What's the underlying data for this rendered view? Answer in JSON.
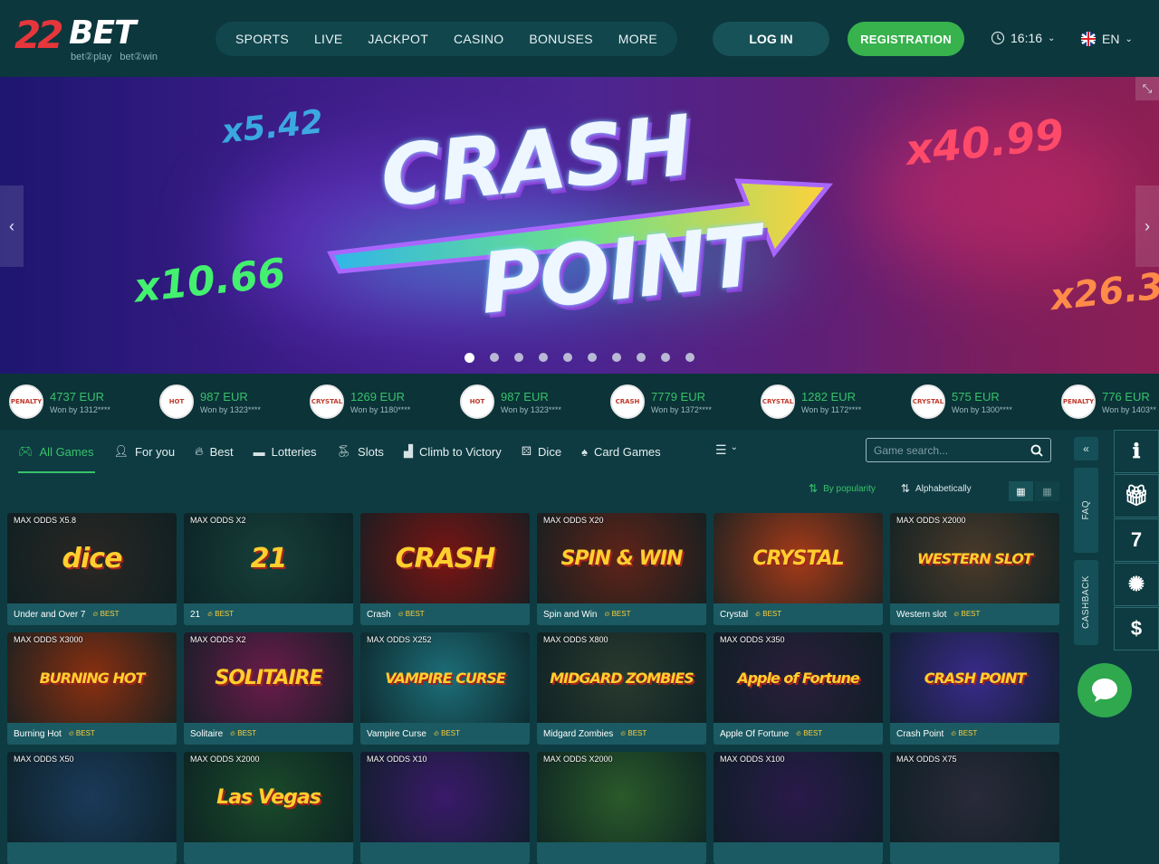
{
  "logo": {
    "number": "22",
    "brand": "BET",
    "tagline": "bet②play bet②win"
  },
  "nav": [
    "SPORTS",
    "LIVE",
    "JACKPOT",
    "CASINO",
    "BONUSES",
    "MORE"
  ],
  "auth": {
    "login": "LOG IN",
    "register": "REGISTRATION"
  },
  "clock": {
    "time": "16:16",
    "icon": "clock-icon"
  },
  "language": {
    "code": "EN",
    "icon": "uk-flag-icon"
  },
  "banner": {
    "title_line1": "CRASH",
    "title_line2": "POINT",
    "multipliers": [
      "x5.42",
      "x40.99",
      "x10.66",
      "x26.3"
    ],
    "slide_count": 10,
    "active_slide": 1
  },
  "winners": [
    {
      "amount": "4737 EUR",
      "by": "Won by 1312****",
      "thumb": "PENALTY"
    },
    {
      "amount": "987 EUR",
      "by": "Won by 1323****",
      "thumb": "HOT"
    },
    {
      "amount": "1269 EUR",
      "by": "Won by 1180****",
      "thumb": "CRYSTAL"
    },
    {
      "amount": "987 EUR",
      "by": "Won by 1323****",
      "thumb": "HOT"
    },
    {
      "amount": "7779 EUR",
      "by": "Won by 1372****",
      "thumb": "CRASH"
    },
    {
      "amount": "1282 EUR",
      "by": "Won by 1172****",
      "thumb": "CRYSTAL"
    },
    {
      "amount": "575 EUR",
      "by": "Won by 1300****",
      "thumb": "CRYSTAL"
    },
    {
      "amount": "776 EUR",
      "by": "Won by 1403**",
      "thumb": "PENALTY"
    }
  ],
  "tabs": [
    {
      "label": "All Games",
      "icon": "gamepad-icon",
      "glyph": "🎮︎",
      "active": true
    },
    {
      "label": "For you",
      "icon": "user-icon",
      "glyph": "👤︎",
      "active": false
    },
    {
      "label": "Best",
      "icon": "fire-icon",
      "glyph": "🔥︎",
      "active": false
    },
    {
      "label": "Lotteries",
      "icon": "ticket-icon",
      "glyph": "▬",
      "active": false
    },
    {
      "label": "Slots",
      "icon": "cherries-icon",
      "glyph": "🍒︎",
      "active": false
    },
    {
      "label": "Climb to Victory",
      "icon": "stairs-icon",
      "glyph": "▟",
      "active": false
    },
    {
      "label": "Dice",
      "icon": "dice-icon",
      "glyph": "⚄",
      "active": false
    },
    {
      "label": "Card Games",
      "icon": "spade-icon",
      "glyph": "♠",
      "active": false
    }
  ],
  "more_menu_icon": "list-menu-icon",
  "search": {
    "placeholder": "Game search..."
  },
  "sort": {
    "popularity": "By popularity",
    "alphabetical": "Alphabetically"
  },
  "games": [
    {
      "name": "Under and Over 7",
      "odds": "MAX ODDS X5.8",
      "badge": "BEST",
      "art": "dice",
      "bg": "#2a2723"
    },
    {
      "name": "21",
      "odds": "MAX ODDS X2",
      "badge": "BEST",
      "art": "21",
      "bg": "#17403a"
    },
    {
      "name": "Crash",
      "odds": "",
      "badge": "BEST",
      "art": "CRASH",
      "bg": "#7a1413"
    },
    {
      "name": "Spin and Win",
      "odds": "MAX ODDS X20",
      "badge": "BEST",
      "art": "SPIN & WIN",
      "bg": "#5e2318"
    },
    {
      "name": "Crystal",
      "odds": "",
      "badge": "BEST",
      "art": "CRYSTAL",
      "bg": "#a63a18"
    },
    {
      "name": "Western slot",
      "odds": "MAX ODDS X2000",
      "badge": "BEST",
      "art": "WESTERN SLOT",
      "bg": "#4a3a2a"
    },
    {
      "name": "Burning Hot",
      "odds": "MAX ODDS X3000",
      "badge": "BEST",
      "art": "BURNING HOT",
      "bg": "#8a2f10"
    },
    {
      "name": "Solitaire",
      "odds": "MAX ODDS X2",
      "badge": "BEST",
      "art": "SOLITAIRE",
      "bg": "#6a1b4a"
    },
    {
      "name": "Vampire Curse",
      "odds": "MAX ODDS X252",
      "badge": "BEST",
      "art": "VAMPIRE CURSE",
      "bg": "#1d6e78"
    },
    {
      "name": "Midgard Zombies",
      "odds": "MAX ODDS X800",
      "badge": "BEST",
      "art": "MIDGARD ZOMBIES",
      "bg": "#2a3a2f"
    },
    {
      "name": "Apple Of Fortune",
      "odds": "MAX ODDS X350",
      "badge": "BEST",
      "art": "Apple of Fortune",
      "bg": "#2a1e3a"
    },
    {
      "name": "Crash Point",
      "odds": "",
      "badge": "BEST",
      "art": "CRASH POINT",
      "bg": "#3a2a8a"
    },
    {
      "name": "",
      "odds": "MAX ODDS X50",
      "badge": "",
      "art": "",
      "bg": "#1b3a5a"
    },
    {
      "name": "",
      "odds": "MAX ODDS X2000",
      "badge": "",
      "art": "Las Vegas",
      "bg": "#1a4a2a"
    },
    {
      "name": "",
      "odds": "MAX ODDS X10",
      "badge": "",
      "art": "",
      "bg": "#3a1a6a"
    },
    {
      "name": "",
      "odds": "MAX ODDS X2000",
      "badge": "",
      "art": "",
      "bg": "#2a5a2a"
    },
    {
      "name": "",
      "odds": "MAX ODDS X100",
      "badge": "",
      "art": "",
      "bg": "#2a1a4a"
    },
    {
      "name": "",
      "odds": "MAX ODDS X75",
      "badge": "",
      "art": "",
      "bg": "#2a2a3a"
    }
  ],
  "side_tabs": {
    "collapse": "«",
    "faq": "FAQ",
    "cashback": "CASHBACK"
  },
  "right_bar": [
    {
      "icon": "info-icon",
      "glyph": "ℹ"
    },
    {
      "icon": "gift-icon",
      "glyph": "🎁︎"
    },
    {
      "icon": "seven-icon",
      "glyph": "7"
    },
    {
      "icon": "wheel-icon",
      "glyph": "✺"
    },
    {
      "icon": "dollar-icon",
      "glyph": "$"
    }
  ],
  "colors": {
    "accent": "#37c26a",
    "bg": "#0e3b42",
    "header": "#0c373d"
  }
}
